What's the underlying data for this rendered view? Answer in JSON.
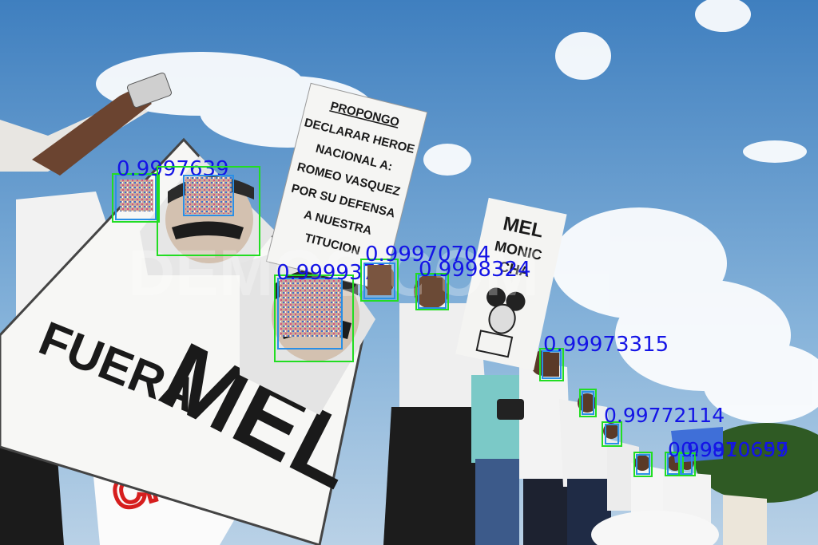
{
  "signs": {
    "left_big": {
      "word1": "FUERA",
      "word2": "MEL"
    },
    "propongo": {
      "lines": [
        "PROPONGO",
        "DECLARAR HEROE",
        "NACIONAL A:",
        "ROMEO VASQUEZ",
        "POR SU DEFENSA",
        "A NUESTRA",
        "TITUCION"
      ]
    },
    "right_sign": {
      "lines": [
        "MEL",
        "MONIC",
        "CHA"
      ]
    },
    "cnn_logo": "CNN",
    "watermark": "DEMOS.COM"
  },
  "detections": [
    {
      "id": "d1",
      "score": "0.9997639"
    },
    {
      "id": "d2",
      "score": ""
    },
    {
      "id": "d3",
      "score": "0.9999372"
    },
    {
      "id": "d4",
      "score": "0.99970704"
    },
    {
      "id": "d5",
      "score": "0.9998324"
    },
    {
      "id": "d6",
      "score": "0.99973315"
    },
    {
      "id": "d7",
      "score": ""
    },
    {
      "id": "d8",
      "score": "0.99772114"
    },
    {
      "id": "d9",
      "score": ""
    },
    {
      "id": "d10",
      "score": "0.99810697"
    },
    {
      "id": "d11",
      "score": "0.9970659"
    }
  ],
  "colors": {
    "green_box": "#22dd22",
    "blue_box": "#2a8fe6",
    "label_text": "#1414e6"
  }
}
